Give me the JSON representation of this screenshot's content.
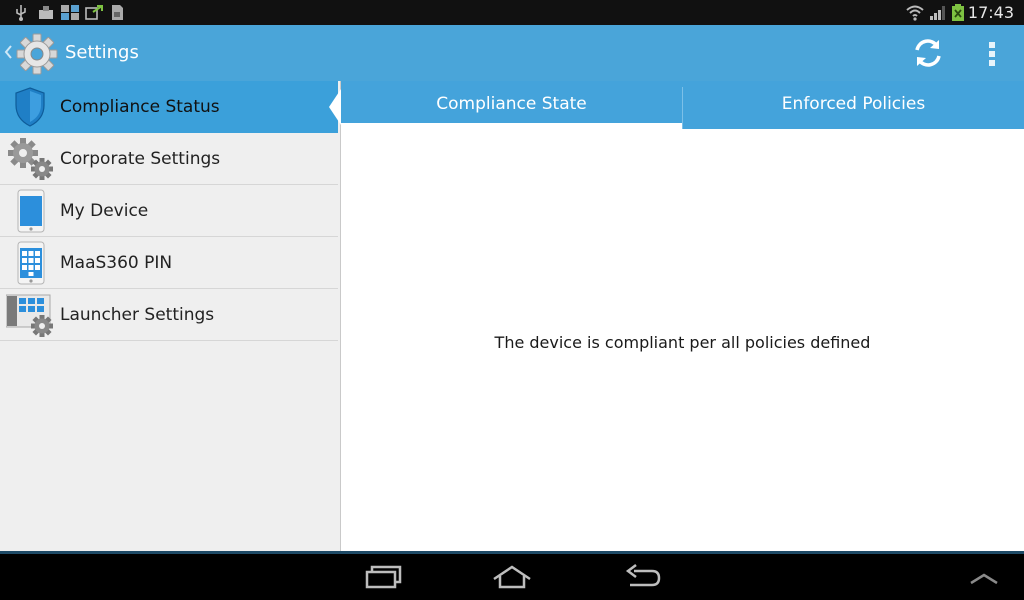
{
  "status_bar": {
    "time": "17:43",
    "icons": [
      "usb-icon",
      "download-icon",
      "screenshot-icon",
      "update-icon",
      "sim-icon",
      "wifi-icon",
      "signal-icon",
      "battery-icon"
    ]
  },
  "action_bar": {
    "title": "Settings",
    "icons": [
      "back-chevron-icon",
      "gear-icon",
      "refresh-icon",
      "overflow-menu-icon"
    ]
  },
  "sidebar": {
    "items": [
      {
        "label": "Compliance Status",
        "icon": "shield-icon",
        "active": true
      },
      {
        "label": "Corporate Settings",
        "icon": "gears-icon",
        "active": false
      },
      {
        "label": "My Device",
        "icon": "phone-icon",
        "active": false
      },
      {
        "label": "MaaS360 PIN",
        "icon": "keypad-phone-icon",
        "active": false
      },
      {
        "label": "Launcher Settings",
        "icon": "launcher-gear-icon",
        "active": false
      }
    ]
  },
  "tabs": [
    {
      "label": "Compliance State",
      "selected": true
    },
    {
      "label": "Enforced Policies",
      "selected": false
    }
  ],
  "content": {
    "message": "The device is compliant per all policies defined"
  },
  "colors": {
    "action_bar": "#4aa5d9",
    "active_item": "#3ba0da",
    "tab_bar": "#44a3db",
    "sidebar_bg": "#efefef"
  },
  "nav_bar": {
    "icons": [
      "recent-apps-icon",
      "home-icon",
      "back-icon",
      "expand-up-icon"
    ]
  }
}
